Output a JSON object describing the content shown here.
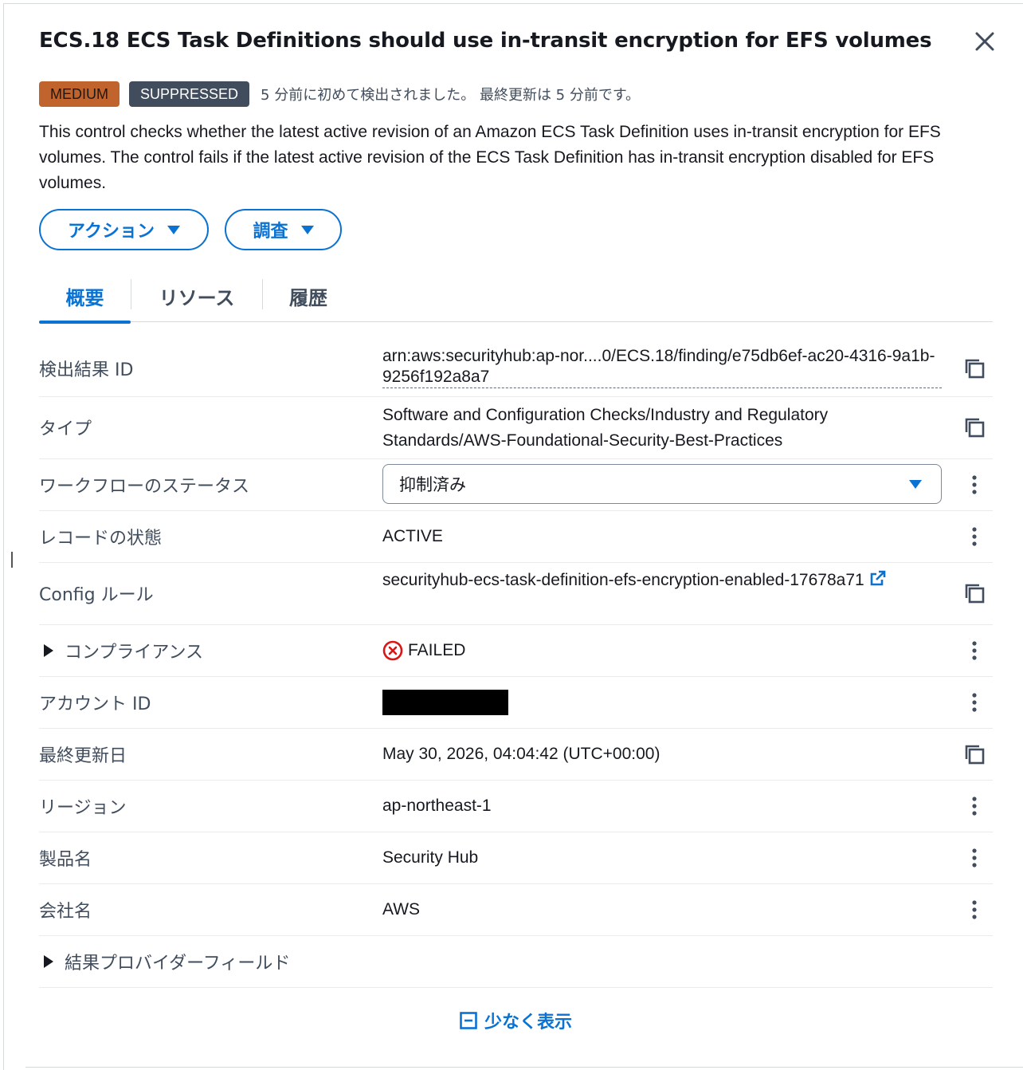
{
  "title": "ECS.18 ECS Task Definitions should use in-transit encryption for EFS volumes",
  "badges": {
    "severity": "MEDIUM",
    "workflow": "SUPPRESSED"
  },
  "detected_text": "5 分前に初めて検出されました。 最終更新は 5 分前です。",
  "description": "This control checks whether the latest active revision of an Amazon ECS Task Definition uses in-transit encryption for EFS volumes. The control fails if the latest active revision of the ECS Task Definition has in-transit encryption disabled for EFS volumes.",
  "buttons": {
    "actions": "アクション",
    "investigate": "調査"
  },
  "tabs": [
    "概要",
    "リソース",
    "履歴"
  ],
  "details": {
    "finding_id": {
      "label": "検出結果 ID",
      "value": "arn:aws:securityhub:ap-nor....0/ECS.18/finding/e75db6ef-ac20-4316-9a1b-9256f192a8a7"
    },
    "type": {
      "label": "タイプ",
      "value": "Software and Configuration Checks/Industry and Regulatory Standards/AWS-Foundational-Security-Best-Practices"
    },
    "workflow_status": {
      "label": "ワークフローのステータス",
      "value": "抑制済み"
    },
    "record_state": {
      "label": "レコードの状態",
      "value": "ACTIVE"
    },
    "config_rule": {
      "label": "Config ルール",
      "value": "securityhub-ecs-task-definition-efs-encryption-enabled-17678a71"
    },
    "compliance": {
      "label": "コンプライアンス",
      "value": "FAILED"
    },
    "account_id": {
      "label": "アカウント ID"
    },
    "last_updated": {
      "label": "最終更新日",
      "value": "May 30, 2026, 04:04:42 (UTC+00:00)"
    },
    "region": {
      "label": "リージョン",
      "value": "ap-northeast-1"
    },
    "product_name": {
      "label": "製品名",
      "value": "Security Hub"
    },
    "company_name": {
      "label": "会社名",
      "value": "AWS"
    },
    "provider_fields": {
      "label": "結果プロバイダーフィールド"
    }
  },
  "show_less": "少なく表示",
  "colors": {
    "accent": "#0972d3",
    "medium": "#c0632c",
    "suppressed": "#414d5c",
    "failed": "#d91515"
  }
}
